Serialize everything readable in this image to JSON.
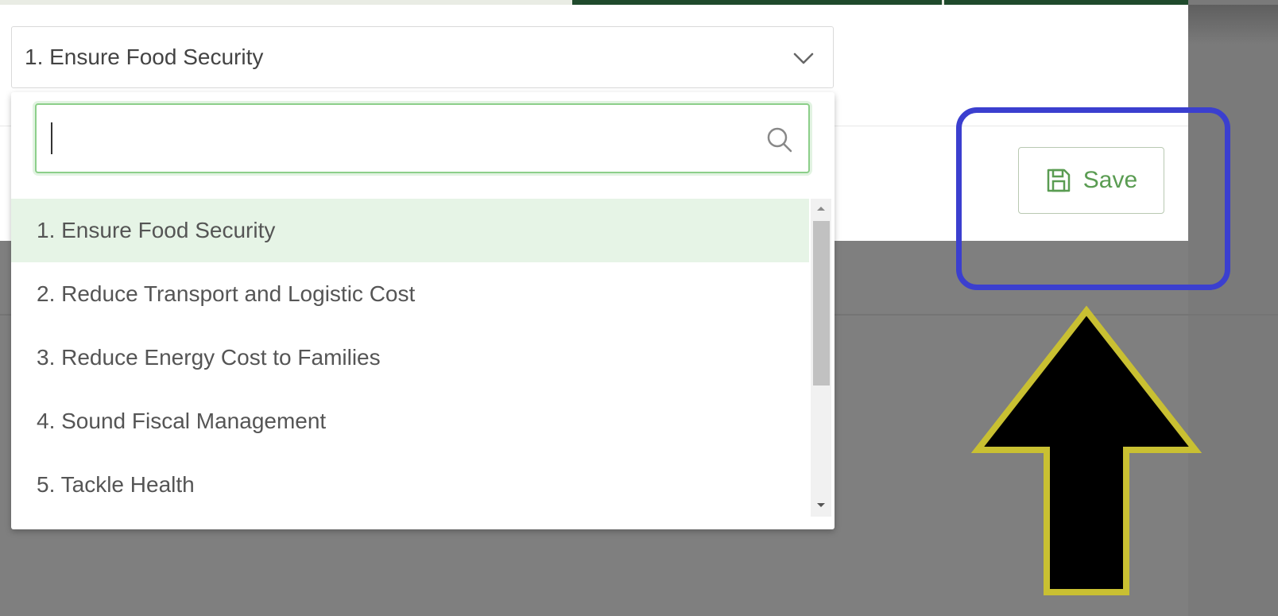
{
  "select": {
    "value": "1. Ensure Food Security",
    "chevron_icon": "chevron-down-icon"
  },
  "dropdown": {
    "search": {
      "value": "",
      "placeholder": "",
      "icon": "search-icon"
    },
    "options": [
      {
        "label": "1. Ensure Food Security",
        "selected": true
      },
      {
        "label": "2. Reduce Transport and Logistic Cost",
        "selected": false
      },
      {
        "label": "3. Reduce Energy Cost to Families",
        "selected": false
      },
      {
        "label": "4. Sound Fiscal Management",
        "selected": false
      },
      {
        "label": "5. Tackle Health",
        "selected": false
      }
    ]
  },
  "toolbar": {
    "save_label": "Save",
    "save_icon": "save-icon"
  },
  "colors": {
    "accent_green": "#5a9c52",
    "focus_border": "#8ccf8a",
    "selected_option_bg": "#e6f4e6",
    "annotation_box": "#3b3fcf",
    "annotation_arrow_outline": "#c9c032",
    "annotation_arrow_fill": "#000000",
    "backdrop": "#7f7f7f"
  }
}
